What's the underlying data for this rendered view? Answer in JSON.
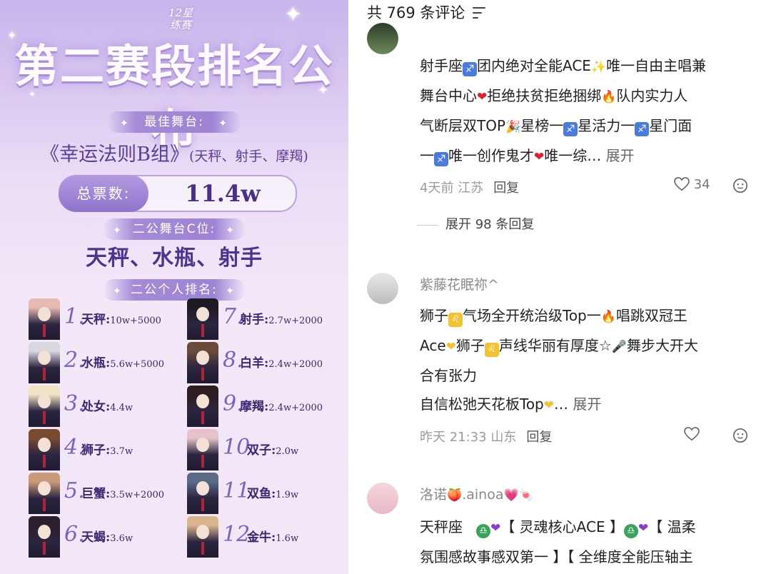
{
  "poster": {
    "logo": "12星\n练赛",
    "title": "第二赛段排名公布",
    "best_stage_label": "最佳舞台:",
    "best_stage_name": "《幸运法则B组》",
    "best_stage_members": "(天秤、射手、摩羯)",
    "total_votes_label": "总票数:",
    "total_votes_value": "11.4w",
    "c_position_label": "二公舞台C位:",
    "c_position_names": "天秤、水瓶、射手",
    "ranking_label": "二公个人排名:",
    "rankings": [
      {
        "rank": "1.",
        "name": "天秤:",
        "votes": "10w+5000"
      },
      {
        "rank": "2.",
        "name": "水瓶:",
        "votes": "5.6w+5000"
      },
      {
        "rank": "3.",
        "name": "处女:",
        "votes": "4.4w"
      },
      {
        "rank": "4.",
        "name": "狮子:",
        "votes": "3.7w"
      },
      {
        "rank": "5.",
        "name": "巨蟹:",
        "votes": "3.5w+2000"
      },
      {
        "rank": "6.",
        "name": "天蝎:",
        "votes": "3.6w"
      },
      {
        "rank": "7.",
        "name": "射手:",
        "votes": "2.7w+2000"
      },
      {
        "rank": "8.",
        "name": "白羊:",
        "votes": "2.4w+2000"
      },
      {
        "rank": "9.",
        "name": "摩羯:",
        "votes": "2.4w+2000"
      },
      {
        "rank": "10.",
        "name": "双子:",
        "votes": "2.0w"
      },
      {
        "rank": "11.",
        "name": "双鱼:",
        "votes": "1.9w"
      },
      {
        "rank": "12.",
        "name": "金牛:",
        "votes": "1.6w"
      }
    ]
  },
  "comments_panel": {
    "header": "共 769 条评论",
    "comments": [
      {
        "username": "",
        "lines": [
          "射手座",
          "团内绝对全能ACE",
          "唯一自由主唱兼",
          "舞台中心",
          "拒绝扶贫拒绝捆绑",
          "队内实力人",
          "气断层双TOP",
          "星榜一",
          "星活力一",
          "星门面",
          "一",
          "唯一创作鬼才",
          "唯一综…"
        ],
        "expand": "展开",
        "time_location": "4天前 江苏",
        "reply": "回复",
        "likes": "34"
      },
      {
        "username": "紫藤花眠祢^",
        "lines": [
          "狮子",
          "气场全开统治级Top一",
          "唱跳双冠王",
          "Ace",
          "狮子",
          "声线华丽有厚度☆",
          "舞步大开大",
          "合有张力",
          "自信松弛天花板Top",
          "…"
        ],
        "expand": "展开",
        "time_location": "昨天 21:33 山东",
        "reply": "回复",
        "likes": ""
      },
      {
        "username": "洛诺",
        "username_suffix": ".ainoa",
        "lines": [
          "天秤座",
          "【 灵魂核心ACE 】",
          "【 温柔",
          "氛围感故事感双第一 】【 全维度全能压轴主"
        ]
      }
    ],
    "expand_replies": "展开 98 条回复"
  },
  "colors": {
    "poster_purple": "#7d62c0",
    "accent_violet": "#4e3490"
  }
}
